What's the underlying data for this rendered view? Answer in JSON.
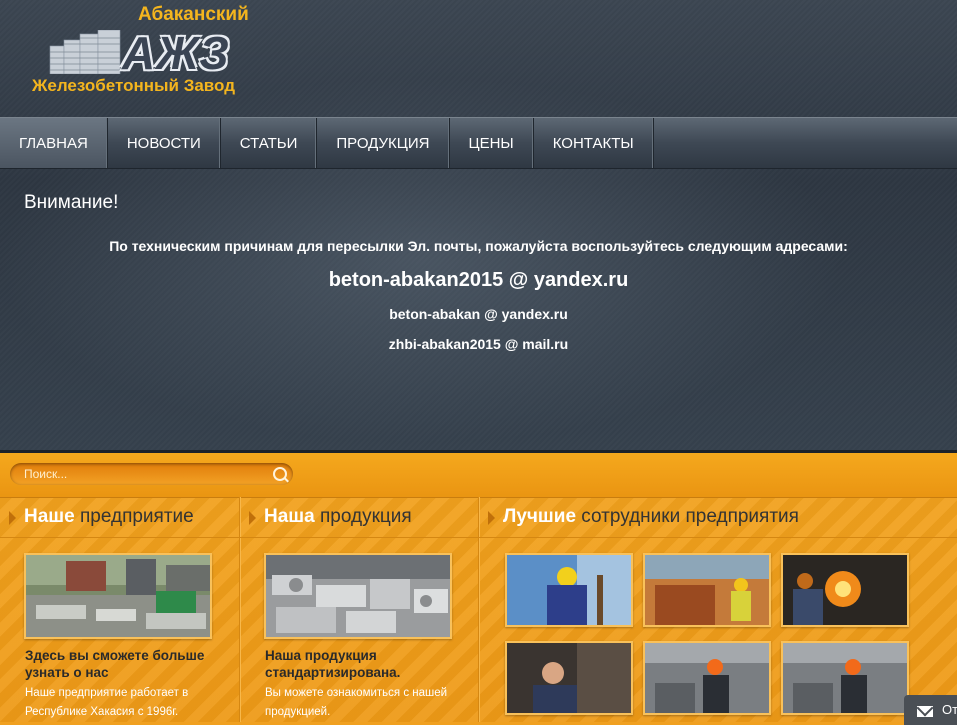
{
  "logo": {
    "line1": "Абаканский",
    "mark": "АЖЗ",
    "line2": "Железобетонный Завод"
  },
  "nav": {
    "items": [
      "ГЛАВНАЯ",
      "НОВОСТИ",
      "СТАТЬИ",
      "ПРОДУКЦИЯ",
      "ЦЕНЫ",
      "КОНТАКТЫ"
    ]
  },
  "notice": {
    "heading": "Внимание!",
    "text": "По техническим причинам  для пересылки Эл. почты, пожалуйста воспользуйтесь следующим адресами:",
    "email_main": "beton-abakan2015 @ yandex.ru",
    "email_2": "beton-abakan @ yandex.ru",
    "email_3": "zhbi-abakan2015 @ mail.ru"
  },
  "search": {
    "placeholder": "Поиск..."
  },
  "columns": {
    "enterprise": {
      "title_bold": "Наше",
      "title_rest": " предприятие",
      "caption": "Здесь вы сможете больше узнать о нас",
      "desc": "Наше предприятие работает в Республике Хакасия с 1996г."
    },
    "products": {
      "title_bold": "Наша",
      "title_rest": " продукция",
      "caption": "Наша продукция стандартизирована.",
      "desc": "Вы можете ознакомиться с нашей продукцией."
    },
    "workers": {
      "title_bold": "Лучшие",
      "title_rest": " сотрудники предприятия"
    }
  },
  "feedback": {
    "label": "От"
  },
  "colors": {
    "accent": "#f2a31f",
    "header_dark": "#2e3742",
    "nav_text": "#ffffff"
  }
}
